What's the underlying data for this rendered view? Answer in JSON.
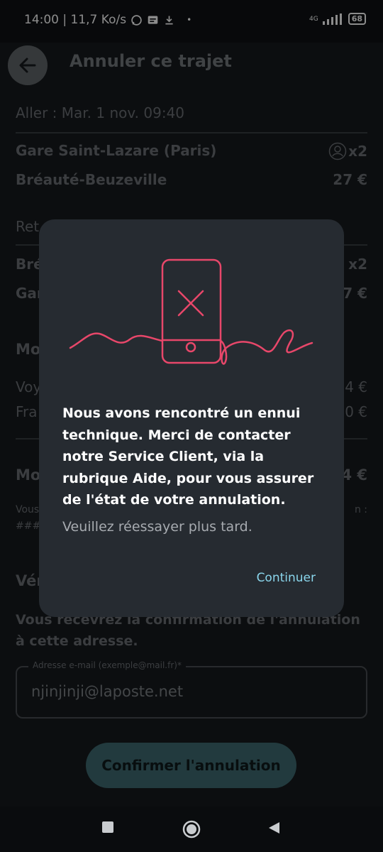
{
  "status_bar": {
    "left_text": "14:00 | 11,7 Ko/s",
    "network": "4G",
    "battery": "68"
  },
  "header": {
    "title": "Annuler ce trajet"
  },
  "outbound": {
    "label": "Aller : Mar. 1 nov. 09:40",
    "origin": "Gare Saint-Lazare (Paris)",
    "passengers": "x2",
    "destination": "Bréauté-Beuzeville",
    "price": "27 €"
  },
  "return": {
    "label_partial": "Ret",
    "origin_partial": "Bré",
    "passengers_partial": "x2",
    "destination_partial": "Gar",
    "price_partial": "7 €"
  },
  "amounts": {
    "section_partial": "Mo",
    "trip_label_partial": "Voy",
    "trip_value_partial": "4 €",
    "fees_label_partial": "Fra",
    "fees_value_partial": "0 €",
    "total_label_partial": "Mo",
    "total_value_partial": "4 €",
    "note_partial_left": "Vous",
    "note_partial_right": "n :",
    "note_hash_partial": "###"
  },
  "verification": {
    "title_partial": "Vér",
    "text": "Vous recevrez la confirmation de l'annulation à cette adresse."
  },
  "email": {
    "label": "Adresse e-mail (exemple@mail.fr)*",
    "value": "njinjinji@laposte.net"
  },
  "confirm_button": "Confirmer l'annulation",
  "dialog": {
    "message": "Nous avons rencontré un ennui technique. Merci de contacter notre Service Client, via la rubrique Aide, pour vous assurer de l'état de votre annulation.",
    "sub": "Veuillez réessayer plus tard.",
    "continue_label": "Continuer",
    "accent_color": "#e8476a"
  }
}
